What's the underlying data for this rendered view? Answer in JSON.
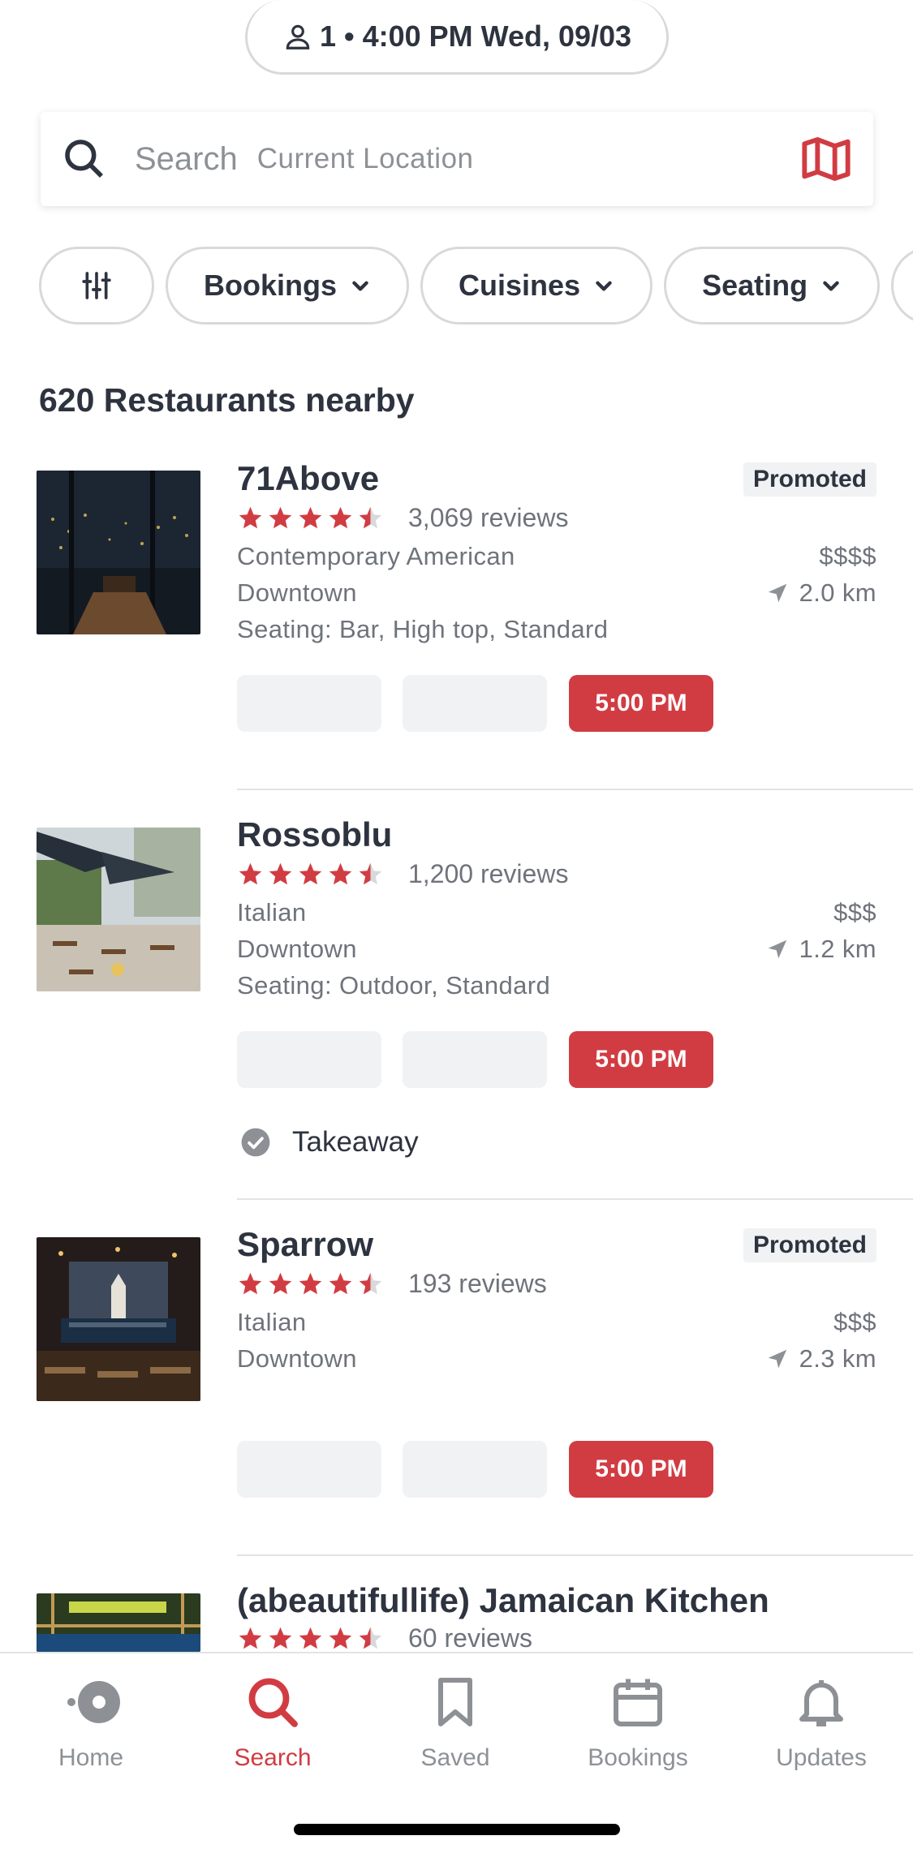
{
  "header": {
    "party_time": "1 • 4:00 PM Wed, 09/03"
  },
  "search": {
    "label": "Search",
    "location": "Current Location"
  },
  "filters": [
    {
      "label": "Bookings"
    },
    {
      "label": "Cuisines"
    },
    {
      "label": "Seating"
    }
  ],
  "results": {
    "title": "620 Restaurants nearby"
  },
  "restaurants": [
    {
      "name": "71Above",
      "promoted": "Promoted",
      "rating": 4.5,
      "reviews": "3,069 reviews",
      "cuisine": "Contemporary American",
      "price": "$$$$",
      "neighborhood": "Downtown",
      "distance": "2.0 km",
      "seating": "Seating: Bar, High top, Standard",
      "slot_time": "5:00 PM"
    },
    {
      "name": "Rossoblu",
      "rating": 4.5,
      "reviews": "1,200 reviews",
      "cuisine": "Italian",
      "price": "$$$",
      "neighborhood": "Downtown",
      "distance": "1.2 km",
      "seating": "Seating: Outdoor, Standard",
      "slot_time": "5:00 PM",
      "extra": "Takeaway"
    },
    {
      "name": "Sparrow",
      "promoted": "Promoted",
      "rating": 4.5,
      "reviews": "193 reviews",
      "cuisine": "Italian",
      "price": "$$$",
      "neighborhood": "Downtown",
      "distance": "2.3 km",
      "slot_time": "5:00 PM"
    },
    {
      "name": "(abeautifullife) Jamaican Kitchen",
      "rating": 4.5,
      "reviews": "60 reviews"
    }
  ],
  "tabbar": {
    "home": "Home",
    "search": "Search",
    "saved": "Saved",
    "bookings": "Bookings",
    "updates": "Updates"
  },
  "colors": {
    "accent": "#d13c42",
    "text": "#2d333f",
    "muted": "#6f737b"
  }
}
